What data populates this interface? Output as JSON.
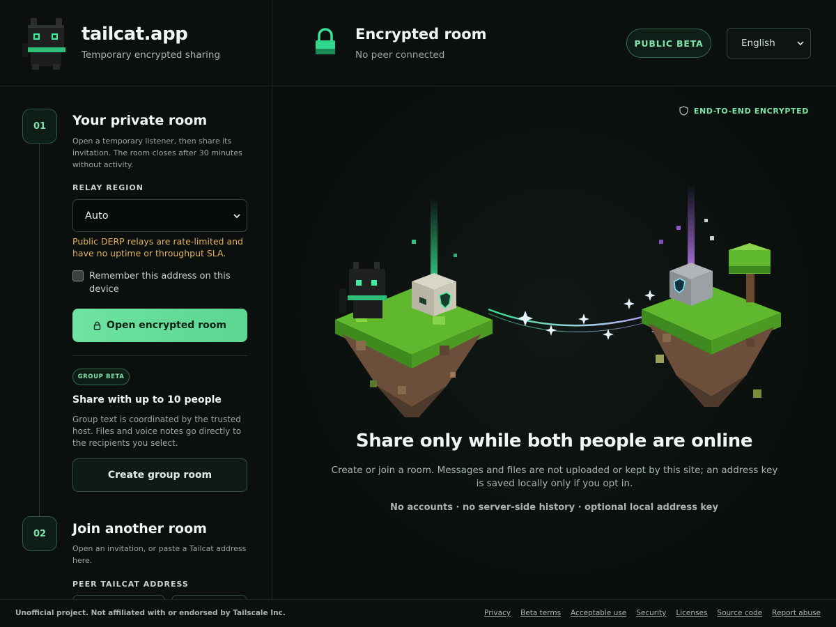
{
  "header": {
    "brand_name": "tailcat.app",
    "brand_tagline": "Temporary encrypted sharing",
    "room_title": "Encrypted room",
    "room_status": "No peer connected",
    "beta_label": "PUBLIC BETA",
    "language_selected": "English"
  },
  "sidebar": {
    "step1": {
      "number": "01",
      "title": "Your private room",
      "description": "Open a temporary listener, then share its invitation. The room closes after 30 minutes without activity.",
      "relay_label": "RELAY REGION",
      "relay_value": "Auto",
      "relay_warning": "Public DERP relays are rate-limited and have no uptime or throughput SLA.",
      "remember_label": "Remember this address on this device",
      "open_button": "Open encrypted room"
    },
    "group": {
      "pill": "GROUP BETA",
      "title": "Share with up to 10 people",
      "description": "Group text is coordinated by the trusted host. Files and voice notes go directly to the recipients you select.",
      "create_button": "Create group room"
    },
    "step2": {
      "number": "02",
      "title": "Join another room",
      "description": "Open an invitation, or paste a Tailcat address here.",
      "peer_label": "PEER TAILCAT ADDRESS"
    }
  },
  "main": {
    "e2e_label": "END-TO-END ENCRYPTED",
    "hero_title": "Share only while both people are online",
    "hero_description": "Create or join a room. Messages and files are not uploaded or kept by this site; an address key is saved locally only if you opt in.",
    "hero_note": "No accounts · no server-side history · optional local address key"
  },
  "footer": {
    "disclaimer": "Unofficial project. Not affiliated with or endorsed by Tailscale Inc.",
    "links": [
      "Privacy",
      "Beta terms",
      "Acceptable use",
      "Security",
      "Licenses",
      "Source code",
      "Report abuse"
    ]
  },
  "colors": {
    "accent": "#6fe3a2",
    "warning": "#e3b25b",
    "background": "#0a0f0d",
    "beam_left": "#3cf0a0",
    "beam_right": "#b36bff"
  },
  "icons": {
    "logo": "voxel-cat-logo",
    "room": "padlock-icon",
    "lock_button": "lock-icon",
    "e2e": "shield-icon",
    "dropdown": "chevron-down-icon"
  }
}
